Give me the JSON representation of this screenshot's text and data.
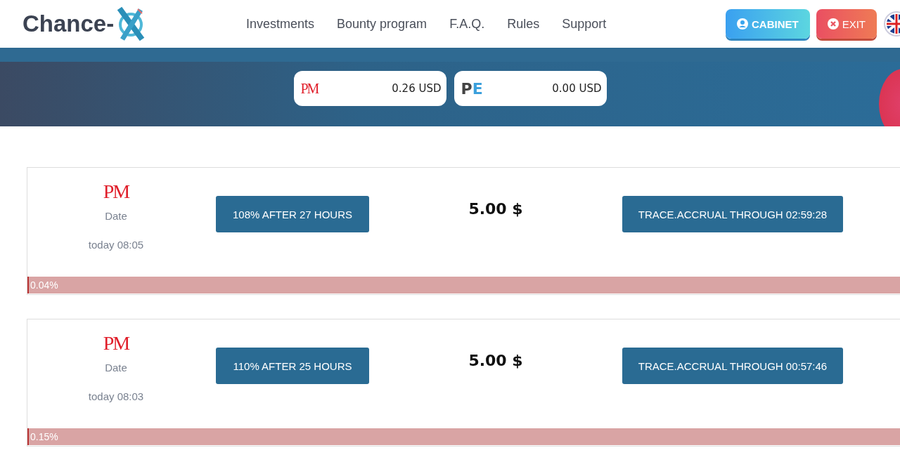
{
  "header": {
    "logo": "Chance-",
    "nav": [
      "Investments",
      "Bounty program",
      "F.A.Q.",
      "Rules",
      "Support"
    ],
    "cabinet_button": "CABINET",
    "exit_button": "EXIT"
  },
  "balances": [
    {
      "kind": "pm",
      "logo": "PM",
      "amount": "0.26 USD"
    },
    {
      "kind": "pe",
      "logo": "PE",
      "amount": "0.00 USD"
    }
  ],
  "deposits": [
    {
      "logo": "PM",
      "date_label": "Date",
      "date": "today 08:05",
      "plan": "108% AFTER 27 HOURS",
      "amount": "5.00 $",
      "accrual": "TRACE.ACCRUAL THROUGH 02:59:28",
      "level": 0.0004,
      "percent": "0.04%"
    },
    {
      "logo": "PM",
      "date_label": "Date",
      "date": "today 08:03",
      "plan": "110% AFTER 25 HOURS",
      "amount": "5.00 $",
      "accrual": "TRACE.ACCRUAL THROUGH 00:57:46",
      "level": 0.0015,
      "percent": "0.15%"
    }
  ]
}
